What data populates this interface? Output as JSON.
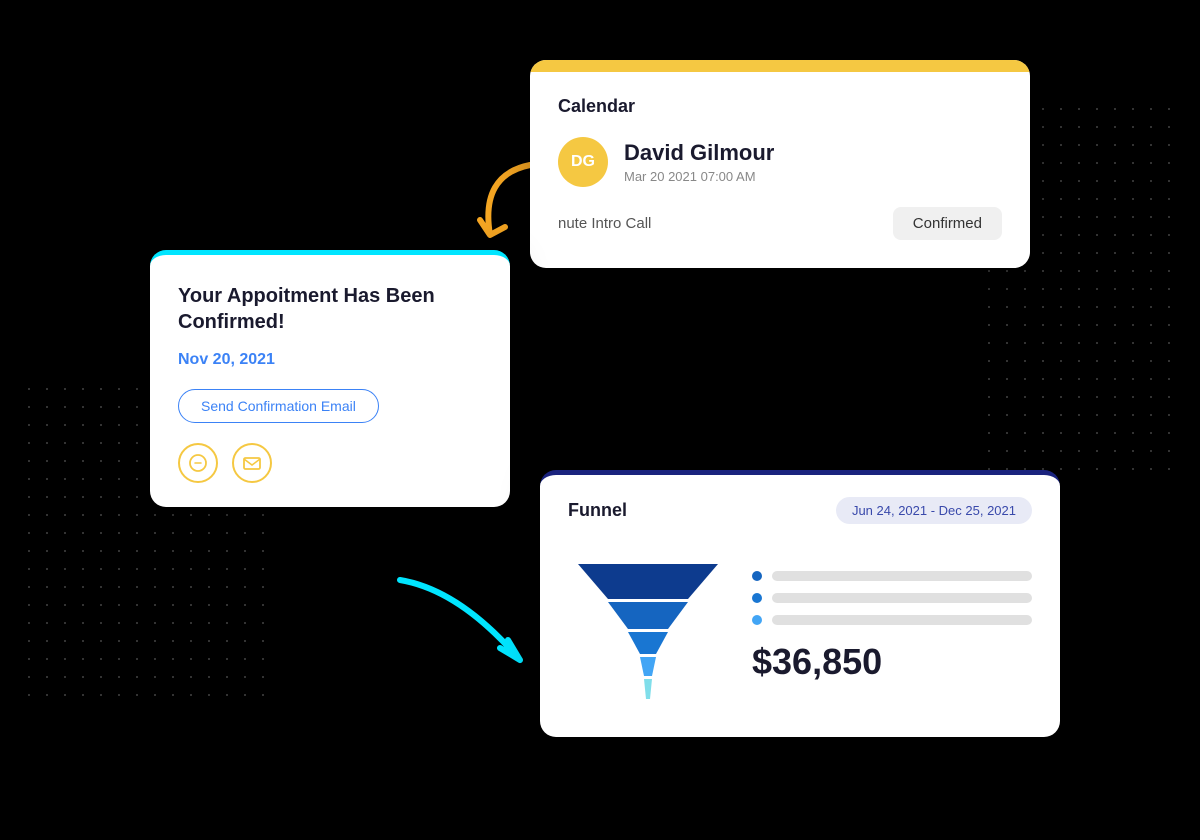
{
  "background": "#000000",
  "calendar": {
    "title": "Calendar",
    "user_initials": "DG",
    "user_name": "David Gilmour",
    "user_date": "Mar 20 2021  07:00 AM",
    "meeting_text": "nute Intro Call",
    "confirmed_label": "Confirmed",
    "header_color": "#F5C842"
  },
  "appointment": {
    "title": "Your Appoitment Has Been Confirmed!",
    "date": "Nov 20, 2021",
    "button_label": "Send Confirmation Email",
    "border_color": "#00E5FF"
  },
  "funnel": {
    "title": "Funnel",
    "date_range": "Jun 24, 2021 - Dec 25, 2021",
    "amount": "$36,850",
    "legend_dots": [
      "#1565c0",
      "#1976d2",
      "#42a5f5"
    ],
    "border_color": "#1a237e"
  },
  "arrows": {
    "orange_color": "#F5A623",
    "cyan_color": "#00E5FF"
  }
}
